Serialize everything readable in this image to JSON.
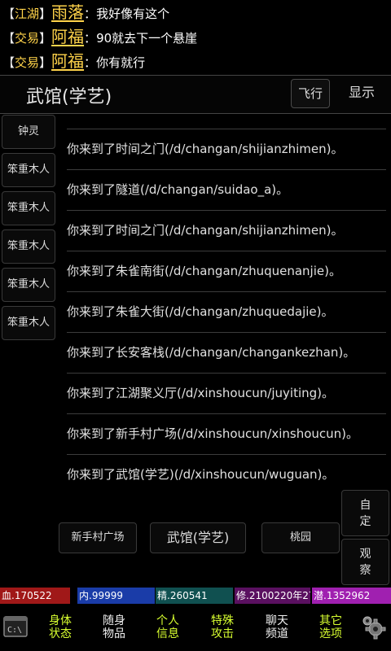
{
  "chat": [
    {
      "channel": "江湖",
      "name": "雨落",
      "message": "我好像有这个"
    },
    {
      "channel": "交易",
      "name": "阿福",
      "message": "90就去下一个悬崖"
    },
    {
      "channel": "交易",
      "name": "阿福",
      "message": "你有就行"
    }
  ],
  "header": {
    "title": "武馆(学艺)",
    "fly": "飞行",
    "show": "显示"
  },
  "npcs": [
    "钟灵",
    "笨重木人",
    "笨重木人",
    "笨重木人",
    "笨重木人",
    "笨重木人"
  ],
  "log": [
    "你来到了时间之门(/d/changan/shijianzhimen)。",
    "你来到了隧道(/d/changan/suidao_a)。",
    "你来到了时间之门(/d/changan/shijianzhimen)。",
    "你来到了朱雀南街(/d/changan/zhuquenanjie)。",
    "你来到了朱雀大街(/d/changan/zhuquedajie)。",
    "你来到了长安客栈(/d/changan/changankezhan)。",
    "你来到了江湖聚义厅(/d/xinshoucun/juyiting)。",
    "你来到了新手村广场(/d/xinshoucun/xinshoucun)。",
    "你来到了武馆(学艺)(/d/xinshoucun/wuguan)。"
  ],
  "exits": [
    "新手村广场",
    "武馆(学艺)",
    "桃园"
  ],
  "side": {
    "auto": "自\n定",
    "watch": "观\n察"
  },
  "stats": {
    "blood": "血.170522",
    "inner": "内.99999",
    "essence": "精.260541",
    "cultivate": "修.2100220年27天",
    "potential": "潜.1352962"
  },
  "nav": [
    {
      "label": "身体\n状态"
    },
    {
      "label": "随身\n物品"
    },
    {
      "label": "个人\n信息"
    },
    {
      "label": "特殊\n攻击"
    },
    {
      "label": "聊天\n频道"
    },
    {
      "label": "其它\n选项"
    }
  ],
  "icons": {
    "command": "command-prompt-icon",
    "settings": "gear-icon"
  },
  "colors": {
    "channel": "#ffd34a",
    "nav_active": "#c8e64a"
  }
}
